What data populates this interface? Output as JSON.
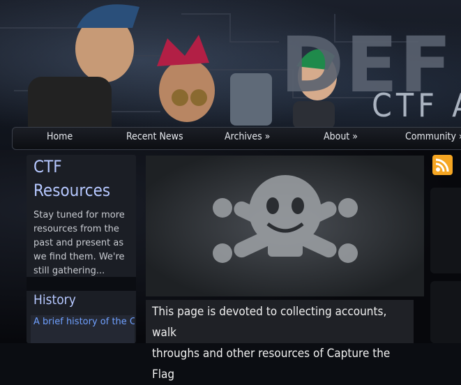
{
  "banner": {
    "logo_text": "DEF C",
    "subtitle": "CTF AR"
  },
  "nav": {
    "items": [
      {
        "label": "Home"
      },
      {
        "label": "Recent News"
      },
      {
        "label": "Archives »"
      },
      {
        "label": "About »"
      },
      {
        "label": "Community »"
      }
    ]
  },
  "sidebar": {
    "title_line1": "CTF",
    "title_line2": "Resources",
    "blurb": "Stay tuned for more resources from the past and present as we find them. We're still gathering...",
    "history_heading": "History",
    "history_link": "A brief history of the Capture the Flag co"
  },
  "main": {
    "intro_line1": "This page is devoted to collecting accounts, walk",
    "intro_line2": "throughs and other resources of Capture the Flag"
  },
  "icons": {
    "rss": "rss-icon",
    "hero": "skull-crossbones-icon"
  },
  "colors": {
    "link": "#6fa0ff",
    "heading": "#b6c8ff",
    "rss": "#f5a623"
  }
}
